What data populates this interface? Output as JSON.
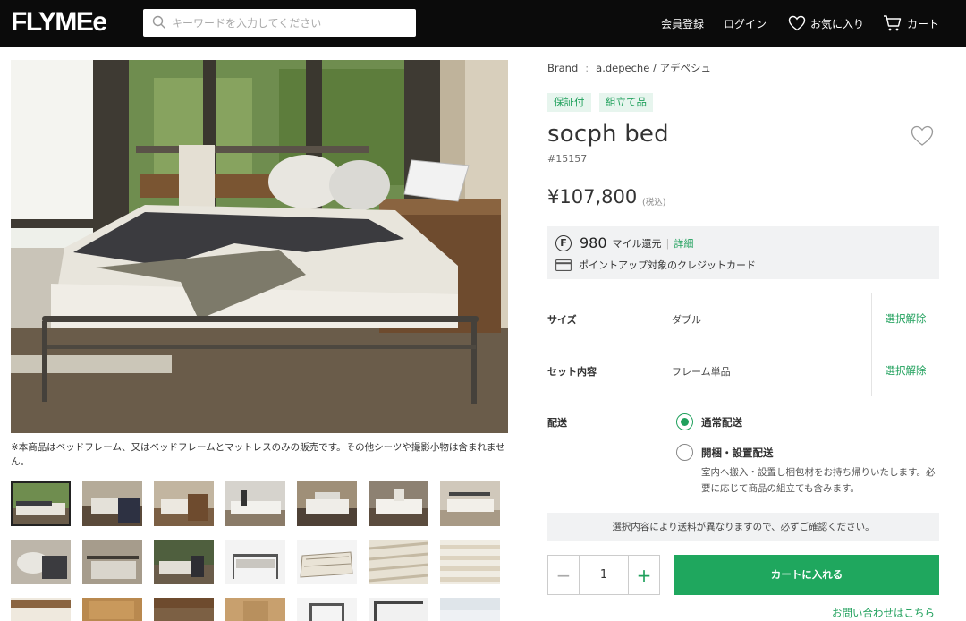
{
  "header": {
    "logo": "FLYMEe",
    "search_placeholder": "キーワードを入力してください",
    "nav": {
      "member": "会員登録",
      "login": "ログイン",
      "favorites": "お気に入り",
      "cart": "カート"
    }
  },
  "gallery": {
    "note": "※本商品はベッドフレーム、又はベッドフレームとマットレスのみの販売です。その他シーツや撮影小物は含まれません。",
    "thumbnail_count": 21
  },
  "product": {
    "brand_label": "Brand",
    "brand_sep": ":",
    "brand_name": "a.depeche / アデペシュ",
    "tags": [
      "保証付",
      "組立て品"
    ],
    "name": "socph bed",
    "id": "#15157",
    "price": "¥107,800",
    "tax_note": "(税込)",
    "mile": {
      "icon_letter": "F",
      "points": "980",
      "label": "マイル還元",
      "sep": "|",
      "detail_link": "詳細",
      "card_text": "ポイントアップ対象のクレジットカード"
    },
    "options": [
      {
        "label": "サイズ",
        "value": "ダブル",
        "clear": "選択解除"
      },
      {
        "label": "セット内容",
        "value": "フレーム単品",
        "clear": "選択解除"
      }
    ],
    "shipping": {
      "label": "配送",
      "normal": "通常配送",
      "setup": "開梱・設置配送",
      "setup_desc": "室内へ搬入・設置し梱包材をお持ち帰りいたします。必要に応じて商品の組立ても含みます。",
      "selected": "normal"
    },
    "notice": "選択内容により送料が異なりますので、必ずご確認ください。",
    "quantity": {
      "minus": "−",
      "value": "1",
      "plus": "+"
    },
    "cart_button": "カートに入れる",
    "contact_link": "お問い合わせはこちら"
  },
  "colors": {
    "header_bg": "#0b0b0b",
    "accent_green": "#1fa75e",
    "tag_bg": "#e7f5ee",
    "panel_bg": "#f1f2f3"
  }
}
